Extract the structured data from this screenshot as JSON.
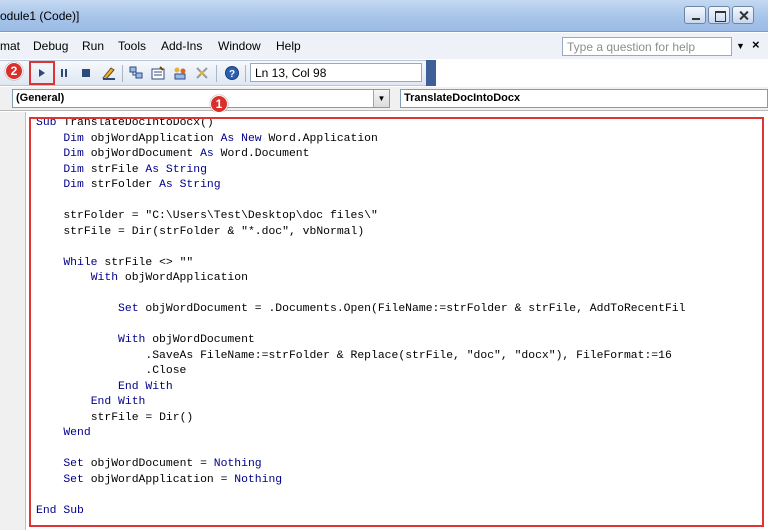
{
  "window": {
    "title": "odule1 (Code)]",
    "minimize_icon": "minimize-icon",
    "maximize_icon": "maximize-icon",
    "close_icon": "close-icon"
  },
  "menu": {
    "items": [
      "mat",
      "Debug",
      "Run",
      "Tools",
      "Add-Ins",
      "Window",
      "Help"
    ],
    "help_placeholder": "Type a question for help",
    "close_glyph": "×"
  },
  "toolbar": {
    "position_text": "Ln 13, Col 98",
    "icons": [
      "run-icon",
      "break-icon",
      "reset-icon",
      "design-mode-icon",
      "project-explorer-icon",
      "properties-icon",
      "object-browser-icon",
      "toolbox-icon",
      "help-icon"
    ]
  },
  "annotations": {
    "badge_code": "1",
    "badge_run": "2",
    "highlight_color": "#e03434"
  },
  "dropdowns": {
    "object": "(General)",
    "procedure": "TranslateDocIntoDocx"
  },
  "colors": {
    "keyword": "#00008b",
    "titlebar": "#a7c4ea"
  },
  "code_lines": [
    "Sub TranslateDocIntoDocx()",
    "    Dim objWordApplication As New Word.Application",
    "    Dim objWordDocument As Word.Document",
    "    Dim strFile As String",
    "    Dim strFolder As String",
    "",
    "    strFolder = \"C:\\Users\\Test\\Desktop\\doc files\\\"",
    "    strFile = Dir(strFolder & \"*.doc\", vbNormal)",
    "",
    "    While strFile <> \"\"",
    "        With objWordApplication",
    "",
    "            Set objWordDocument = .Documents.Open(FileName:=strFolder & strFile, AddToRecentFil",
    "",
    "            With objWordDocument",
    "                .SaveAs FileName:=strFolder & Replace(strFile, \"doc\", \"docx\"), FileFormat:=16",
    "                .Close",
    "            End With",
    "        End With",
    "        strFile = Dir()",
    "    Wend",
    "",
    "    Set objWordDocument = Nothing",
    "    Set objWordApplication = Nothing",
    "",
    "End Sub"
  ],
  "keywords": [
    "Sub",
    "Dim",
    "As",
    "New",
    "String",
    "While",
    "With",
    "Set",
    "End",
    "Wend",
    "Nothing"
  ]
}
